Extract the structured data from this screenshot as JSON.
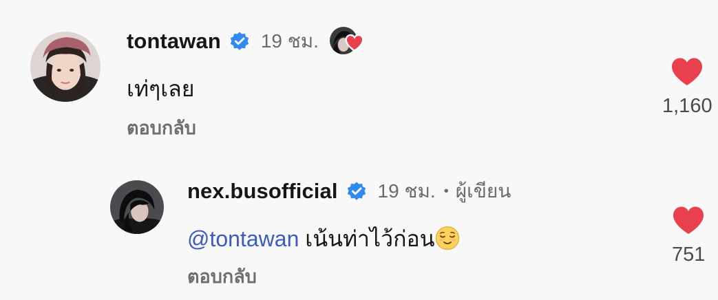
{
  "comments": [
    {
      "username": "tontawan",
      "time": "19 ชม.",
      "text": "เท่ๆเลย",
      "reply_label": "ตอบกลับ",
      "like_count": "1,160",
      "liked_by_author": true
    },
    {
      "username": "nex.busofficial",
      "time": "19 ชม.",
      "separator": "•",
      "author_tag": "ผู้เขียน",
      "mention": "@tontawan",
      "text": "เน้นท่าไว้ก่อน",
      "emoji": "relieved-face",
      "reply_label": "ตอบกลับ",
      "like_count": "751"
    }
  ],
  "colors": {
    "background": "#f8f8f8",
    "verified": "#2f8bf0",
    "heart": "#e8404c",
    "mention": "#3d59c4",
    "muted": "#6b6b6b"
  }
}
